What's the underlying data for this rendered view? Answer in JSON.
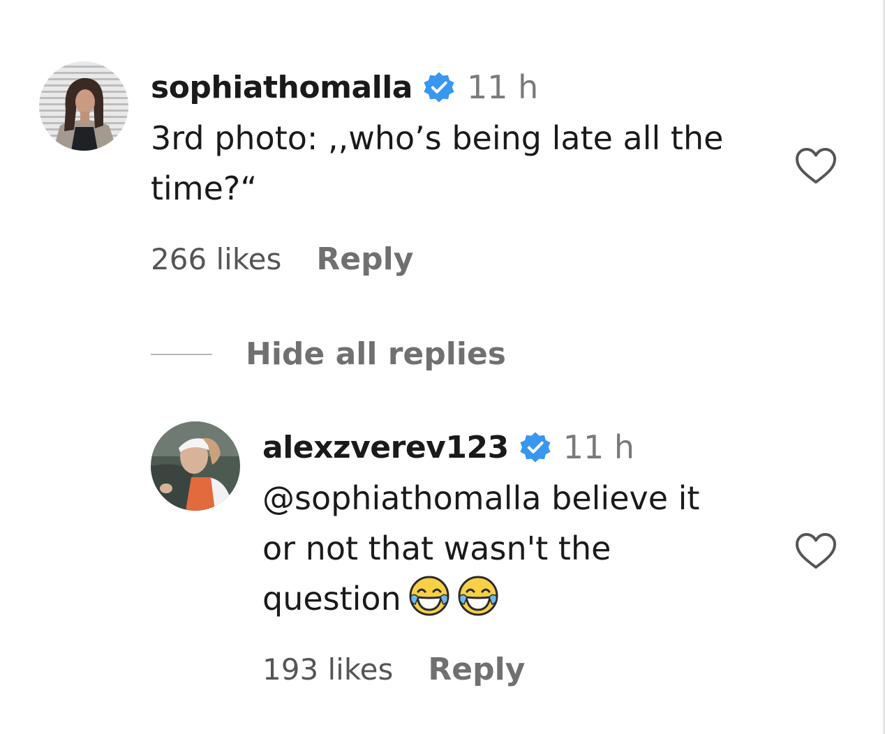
{
  "colors": {
    "verified_badge": "#3897f0",
    "text_primary": "#1a1a1a",
    "text_secondary": "#707070",
    "background": "#ffffff"
  },
  "comments": [
    {
      "username": "sophiathomalla",
      "verified_icon": "verified-badge-icon",
      "time": "11 h",
      "text_lines": [
        "3rd photo: ,,who’s being late all the",
        "time?“"
      ],
      "likes": "266 likes",
      "reply_label": "Reply",
      "like_icon": "heart-outline-icon"
    }
  ],
  "replies_toggle": {
    "label": "Hide all replies"
  },
  "replies": [
    {
      "username": "alexzverev123",
      "verified_icon": "verified-badge-icon",
      "time": "11 h",
      "text_lines": [
        "@sophiathomalla believe it",
        "or not that wasn't the",
        "question"
      ],
      "emojis": [
        "face-with-tears-of-joy",
        "face-with-tears-of-joy"
      ],
      "likes": "193 likes",
      "reply_label": "Reply",
      "like_icon": "heart-outline-icon"
    }
  ]
}
